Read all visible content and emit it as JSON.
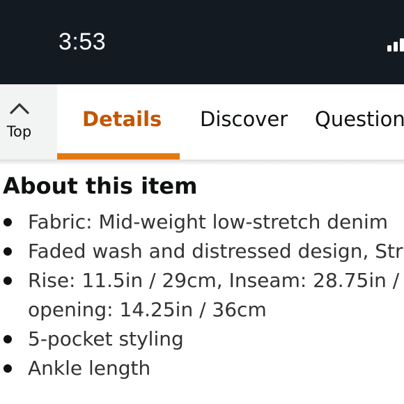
{
  "status_bar": {
    "time": "3:53",
    "background": "#131a22"
  },
  "tabbar": {
    "top_button": {
      "icon": "chevron-up-icon",
      "label": "Top"
    },
    "tabs": [
      {
        "label": "Details",
        "active": true
      },
      {
        "label": "Discover",
        "active": false
      },
      {
        "label": "Question",
        "active": false
      }
    ],
    "active_color": "#c45500",
    "indicator_color": "#e47911"
  },
  "about": {
    "title": "About this item",
    "bullets": [
      {
        "lines": [
          "Fabric: Mid-weight low-stretch denim"
        ]
      },
      {
        "lines": [
          "Faded wash and distressed design, Stra"
        ]
      },
      {
        "lines": [
          "Rise: 11.5in / 29cm, Inseam: 28.75in /",
          "opening: 14.25in / 36cm"
        ]
      },
      {
        "lines": [
          "5-pocket styling"
        ]
      },
      {
        "lines": [
          "Ankle length"
        ]
      }
    ]
  }
}
